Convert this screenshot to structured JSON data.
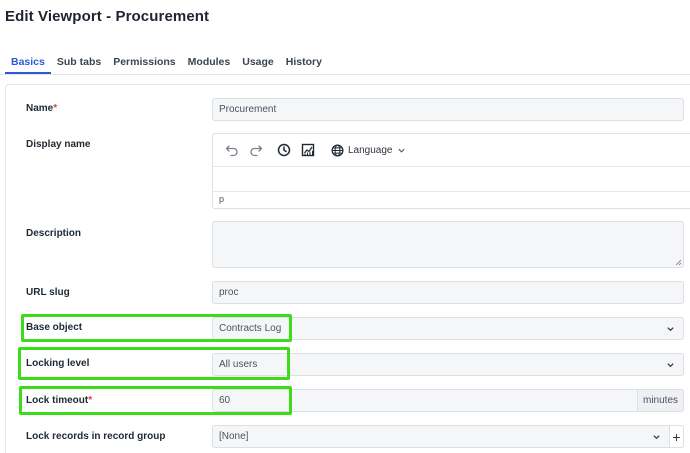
{
  "page": {
    "title": "Edit Viewport - Procurement"
  },
  "tabs": [
    {
      "label": "Basics",
      "active": true
    },
    {
      "label": "Sub tabs",
      "active": false
    },
    {
      "label": "Permissions",
      "active": false
    },
    {
      "label": "Modules",
      "active": false
    },
    {
      "label": "Usage",
      "active": false
    },
    {
      "label": "History",
      "active": false
    }
  ],
  "form": {
    "name": {
      "label": "Name",
      "required_mark": "*",
      "value": "Procurement"
    },
    "display_name": {
      "label": "Display name",
      "language_label": "Language",
      "footer_text": "p"
    },
    "description": {
      "label": "Description",
      "value": ""
    },
    "url_slug": {
      "label": "URL slug",
      "value": "proc"
    },
    "base_object": {
      "label": "Base object",
      "value": "Contracts Log"
    },
    "locking_level": {
      "label": "Locking level",
      "value": "All users"
    },
    "lock_timeout": {
      "label": "Lock timeout",
      "required_mark": "*",
      "value": "60",
      "unit": "minutes"
    },
    "lock_records": {
      "label": "Lock records in record group",
      "value": "[None]",
      "add_label": "+"
    }
  },
  "colors": {
    "accent": "#2c5bd7",
    "highlight": "#3ddc1a",
    "required": "#d64545"
  }
}
